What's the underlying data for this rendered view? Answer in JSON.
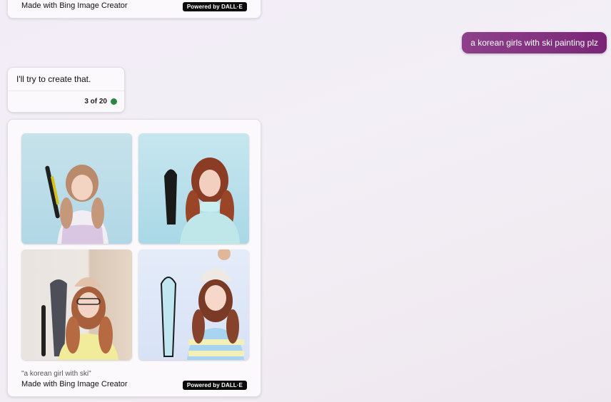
{
  "previous_result": {
    "made_with": "Made with Bing Image Creator",
    "badge": "Powered by DALL·E"
  },
  "user_message": {
    "text": "a korean girls with ski painting plz"
  },
  "bot_message": {
    "text": "I'll try to create that.",
    "counter": "3 of 20",
    "status_color": "#2a8540"
  },
  "image_result": {
    "images": [
      {
        "name": "generated-image-1"
      },
      {
        "name": "generated-image-2"
      },
      {
        "name": "generated-image-3"
      },
      {
        "name": "generated-image-4"
      }
    ],
    "caption": "\"a korean girl with ski\"",
    "made_with": "Made with Bing Image Creator",
    "badge": "Powered by DALL·E"
  },
  "colors": {
    "user_bubble": "#82327f",
    "card_bg": "#fbf9fc",
    "badge_bg": "#0b0b0b"
  }
}
